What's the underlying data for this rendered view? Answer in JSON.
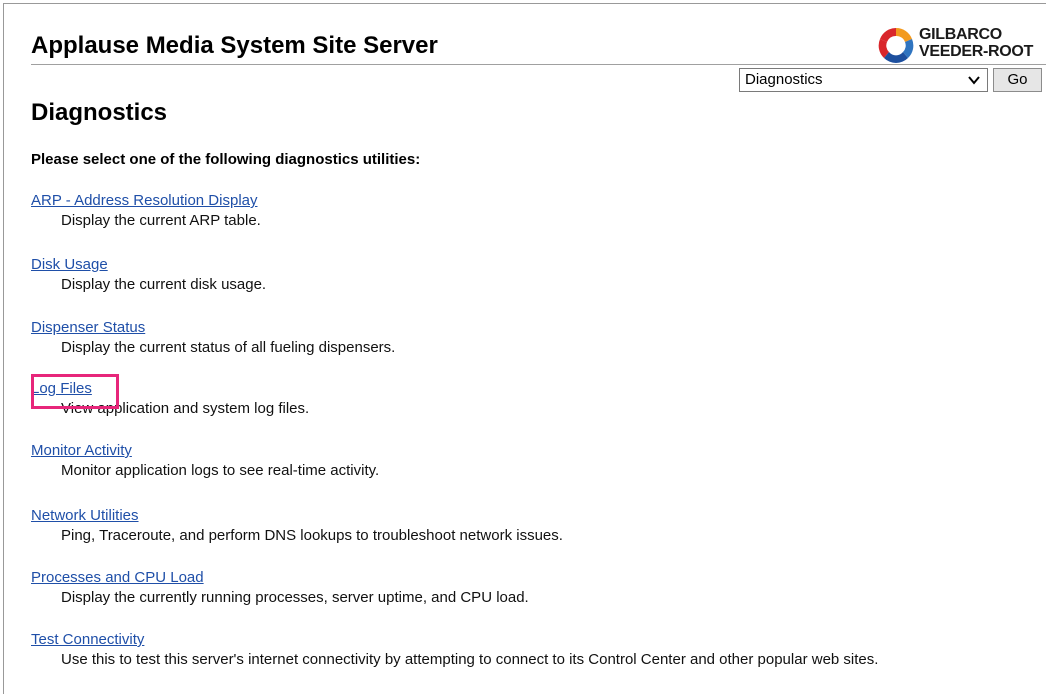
{
  "app": {
    "title": "Applause Media System Site Server"
  },
  "logo": {
    "line1": "GILBARCO",
    "line2": "VEEDER-ROOT"
  },
  "nav": {
    "selected": "Diagnostics",
    "go_label": "Go"
  },
  "page": {
    "heading": "Diagnostics",
    "instructions": "Please select one of the following diagnostics utilities:"
  },
  "utilities": [
    {
      "label": "ARP - Address Resolution Display",
      "description": "Display the current ARP table."
    },
    {
      "label": "Disk Usage",
      "description": "Display the current disk usage."
    },
    {
      "label": "Dispenser Status",
      "description": "Display the current status of all fueling dispensers."
    },
    {
      "label": "Log Files",
      "description": "View application and system log files."
    },
    {
      "label": "Monitor Activity",
      "description": "Monitor application logs to see real-time activity."
    },
    {
      "label": "Network Utilities",
      "description": "Ping, Traceroute, and perform DNS lookups to troubleshoot network issues."
    },
    {
      "label": "Processes and CPU Load",
      "description": "Display the currently running processes, server uptime, and CPU load."
    },
    {
      "label": "Test Connectivity",
      "description": "Use this to test this server's internet connectivity by attempting to connect to its Control Center and other popular web sites."
    }
  ],
  "colors": {
    "link": "#1f4fa8",
    "highlight": "#e7267a",
    "logo_red": "#d9262b",
    "logo_orange": "#f39a1e",
    "logo_blue": "#1d4f9e"
  },
  "icons": {
    "dropdown": "chevron-down-icon",
    "brand": "gilbarco-logo-icon"
  }
}
